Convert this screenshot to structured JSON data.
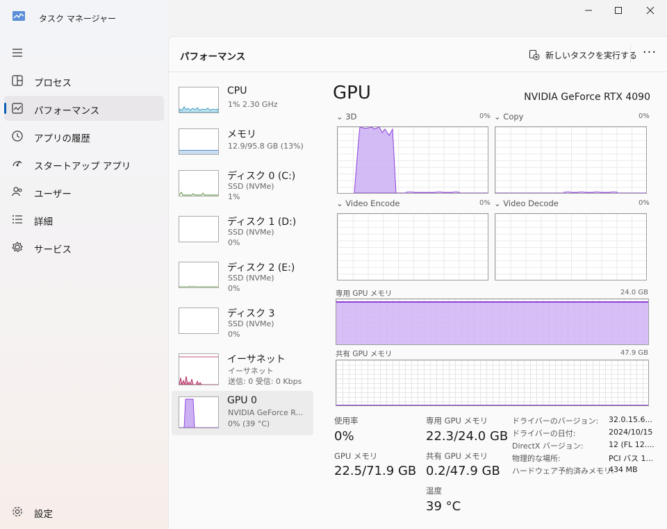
{
  "app": {
    "title": "タスク マネージャー"
  },
  "sidebar": {
    "items": [
      {
        "label": "プロセス",
        "icon": "processes-icon"
      },
      {
        "label": "パフォーマンス",
        "icon": "performance-icon"
      },
      {
        "label": "アプリの履歴",
        "icon": "history-icon"
      },
      {
        "label": "スタートアップ アプリ",
        "icon": "startup-icon"
      },
      {
        "label": "ユーザー",
        "icon": "users-icon"
      },
      {
        "label": "詳細",
        "icon": "details-icon"
      },
      {
        "label": "サービス",
        "icon": "services-icon"
      }
    ],
    "selected": "パフォーマンス",
    "settings_label": "設定"
  },
  "header": {
    "title": "パフォーマンス",
    "new_task_label": "新しいタスクを実行する",
    "more_label": "···"
  },
  "devices": [
    {
      "name": "CPU",
      "line1": "1%  2.30 GHz",
      "line2": ""
    },
    {
      "name": "メモリ",
      "line1": "12.9/95.8 GB (13%)",
      "line2": ""
    },
    {
      "name": "ディスク 0 (C:)",
      "line1": "SSD (NVMe)",
      "line2": "1%"
    },
    {
      "name": "ディスク 1 (D:)",
      "line1": "SSD (NVMe)",
      "line2": "0%"
    },
    {
      "name": "ディスク 2 (E:)",
      "line1": "SSD (NVMe)",
      "line2": "0%"
    },
    {
      "name": "ディスク 3",
      "line1": "SSD (NVMe)",
      "line2": "0%"
    },
    {
      "name": "イーサネット",
      "line1": "イーサネット",
      "line2": "送信: 0  受信: 0 Kbps"
    },
    {
      "name": "GPU 0",
      "line1": "NVIDIA GeForce R...",
      "line2": "0%  (39 °C)"
    }
  ],
  "gpu": {
    "title": "GPU",
    "model": "NVIDIA GeForce RTX 4090",
    "engines": [
      {
        "label": "3D",
        "percent": "0%"
      },
      {
        "label": "Copy",
        "percent": "0%"
      },
      {
        "label": "Video Encode",
        "percent": "0%"
      },
      {
        "label": "Video Decode",
        "percent": "0%"
      }
    ],
    "dedicated_label": "専用 GPU メモリ",
    "dedicated_max": "24.0 GB",
    "dedicated_fraction": 0.93,
    "shared_label": "共有 GPU メモリ",
    "shared_max": "47.9 GB",
    "shared_fraction": 0.004,
    "stats": {
      "usage_label": "使用率",
      "usage_value": "0%",
      "dedicated_label": "専用 GPU メモリ",
      "dedicated_value": "22.3/24.0 GB",
      "gpumem_label": "GPU メモリ",
      "gpumem_value": "22.5/71.9 GB",
      "shared_label": "共有 GPU メモリ",
      "shared_value": "0.2/47.9 GB",
      "temp_label": "温度",
      "temp_value": "39 °C"
    },
    "info": [
      {
        "key": "ドライバーのバージョン:",
        "value": "32.0.15.6..."
      },
      {
        "key": "ドライバーの日付:",
        "value": "2024/10/15"
      },
      {
        "key": "DirectX バージョン:",
        "value": "12 (FL 12...."
      },
      {
        "key": "物理的な場所:",
        "value": "PCI バス 1..."
      },
      {
        "key": "ハードウェア予約済みメモリ:",
        "value": "434 MB"
      }
    ]
  },
  "colors": {
    "accent": "#0a5fb4",
    "gpu_fill": "#cbb0f3",
    "gpu_line": "#8b3fd9",
    "cpu_line": "#1a88b8",
    "net_line": "#a8174f"
  }
}
